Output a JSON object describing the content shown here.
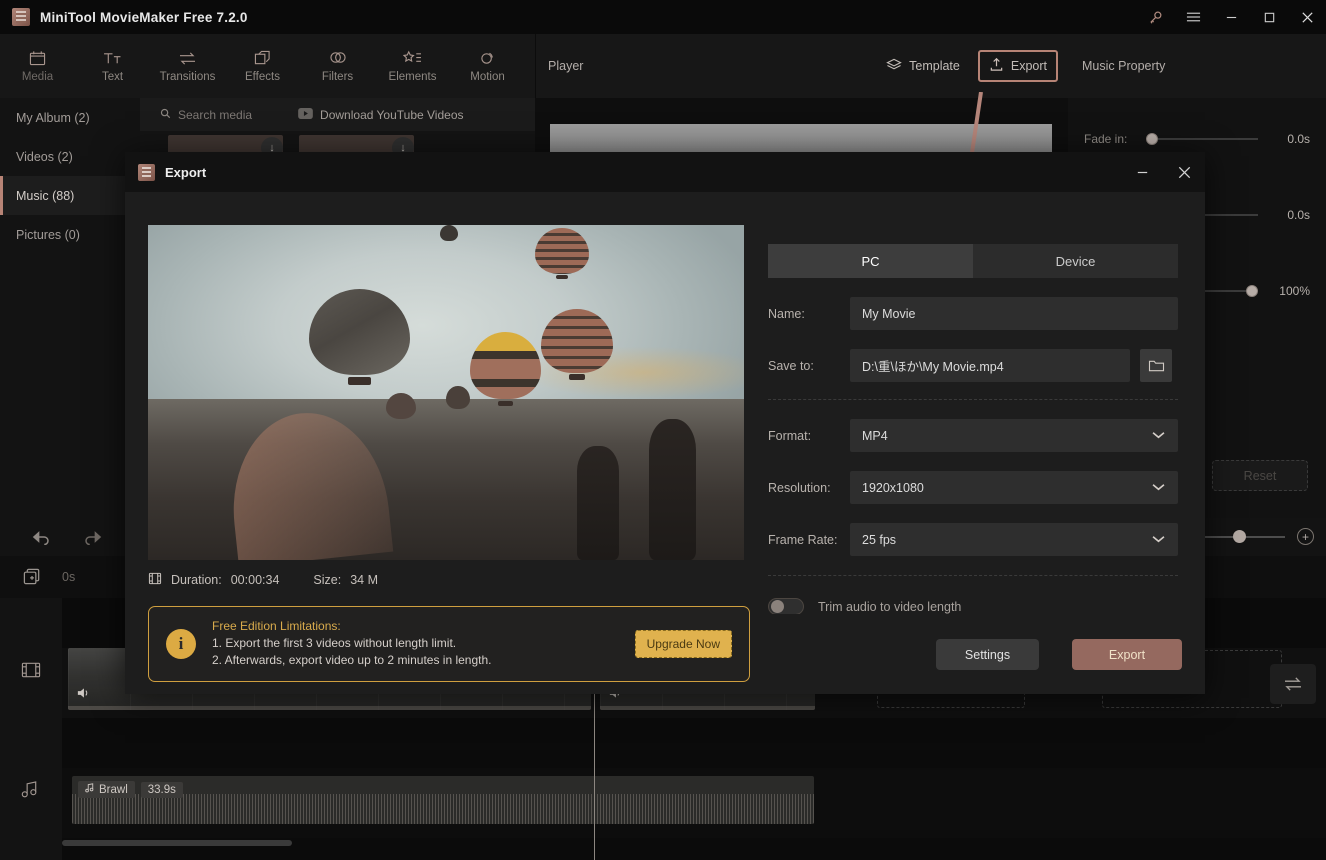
{
  "window": {
    "title": "MiniTool MovieMaker Free 7.2.0",
    "controls": {
      "key": "key-icon",
      "menu": "menu-icon",
      "minimize": "minimize",
      "maximize": "maximize",
      "close": "close"
    }
  },
  "toolbar": {
    "tabs": [
      {
        "label": "Media",
        "icon": "media-icon",
        "active": true
      },
      {
        "label": "Text",
        "icon": "text-icon",
        "active": false
      },
      {
        "label": "Transitions",
        "icon": "transitions-icon",
        "active": false
      },
      {
        "label": "Effects",
        "icon": "effects-icon",
        "active": false
      },
      {
        "label": "Filters",
        "icon": "filters-icon",
        "active": false
      },
      {
        "label": "Elements",
        "icon": "elements-icon",
        "active": false
      },
      {
        "label": "Motion",
        "icon": "motion-icon",
        "active": false
      }
    ]
  },
  "player_header": {
    "title": "Player",
    "template_label": "Template",
    "export_label": "Export"
  },
  "music_property": {
    "title": "Music Property",
    "rows": [
      {
        "label": "Fade in:",
        "value": "0.0s",
        "pos": 8
      },
      {
        "label": "",
        "value": "0.0s",
        "pos": 0
      },
      {
        "label": "",
        "value": "100%",
        "pos": 100
      }
    ],
    "reset_label": "Reset"
  },
  "sidebar": {
    "items": [
      {
        "label": "My Album (2)",
        "active": false
      },
      {
        "label": "Videos (2)",
        "active": false
      },
      {
        "label": "Music (88)",
        "active": true
      },
      {
        "label": "Pictures (0)",
        "active": false
      }
    ]
  },
  "media": {
    "search_placeholder": "Search media",
    "youtube_label": "Download YouTube Videos"
  },
  "timeline": {
    "current_time": "0s",
    "audio_clip": {
      "name": "Brawl",
      "duration": "33.9s"
    },
    "tracks": [
      {
        "icon": "video-track-icon"
      },
      {
        "icon": "music-track-icon"
      }
    ]
  },
  "dialog": {
    "title": "Export",
    "tabs": [
      {
        "label": "PC",
        "active": true
      },
      {
        "label": "Device",
        "active": false
      }
    ],
    "fields": {
      "name_label": "Name:",
      "name_value": "My Movie",
      "saveto_label": "Save to:",
      "saveto_value": "D:\\重\\ほか\\My Movie.mp4",
      "format_label": "Format:",
      "format_value": "MP4",
      "resolution_label": "Resolution:",
      "resolution_value": "1920x1080",
      "framerate_label": "Frame Rate:",
      "framerate_value": "25 fps"
    },
    "trim_toggle": {
      "label": "Trim audio to video length",
      "on": false
    },
    "meta": {
      "duration_label": "Duration:",
      "duration_value": "00:00:34",
      "size_label": "Size:",
      "size_value": "34 M"
    },
    "notice": {
      "heading": "Free Edition Limitations:",
      "line1": "1. Export the first 3 videos without length limit.",
      "line2": "2. Afterwards, export video up to 2 minutes in length.",
      "upgrade_label": "Upgrade Now"
    },
    "actions": {
      "settings_label": "Settings",
      "export_label": "Export"
    }
  },
  "colors": {
    "accent_rose": "#b78476",
    "export_button": "#95695f",
    "notice_border": "#cf9f3f",
    "notice_text": "#d9ab4c",
    "upgrade_bg": "#e0b24e"
  }
}
